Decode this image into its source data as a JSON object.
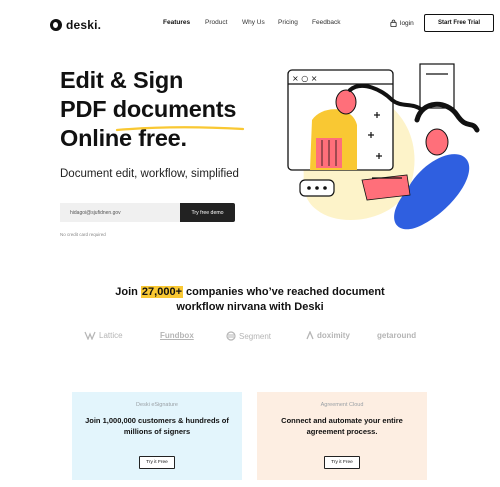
{
  "brand": {
    "name": "deski."
  },
  "nav": {
    "links": [
      "Features",
      "Product",
      "Why Us",
      "Pricing",
      "Feedback"
    ],
    "active": "Features",
    "login": "login",
    "cta": "Start Free Trial"
  },
  "hero": {
    "title_line1": "Edit & Sign",
    "title_line2": "PDF documents",
    "title_line3": "Online free.",
    "subtitle": "Document edit, workflow, simplified",
    "email_value": "hidagoi@sjufidnen.gov",
    "demo_button": "Try free demo",
    "note": "No credit card required"
  },
  "join": {
    "prefix": "Join ",
    "count": "27,000+",
    "suffix": " companies who’ve reached document",
    "line2": "workflow nirvana with Deski"
  },
  "partners": [
    "Lattice",
    "Fundbox",
    "Segment",
    "doximity",
    "getaround"
  ],
  "cards": [
    {
      "tag": "Deski eSignature",
      "title": "Join 1,000,000 customers & hundreds of millions of signers",
      "button": "Try it Free"
    },
    {
      "tag": "Agreement Cloud",
      "title": "Connect and automate your entire agreement process.",
      "button": "Try it Free"
    }
  ],
  "colors": {
    "accent_yellow": "#f9c833",
    "accent_blue": "#2f5fe0",
    "accent_pink": "#ff6f7a",
    "card1_bg": "#e3f5fc",
    "card2_bg": "#fdeee2",
    "text": "#111111"
  }
}
